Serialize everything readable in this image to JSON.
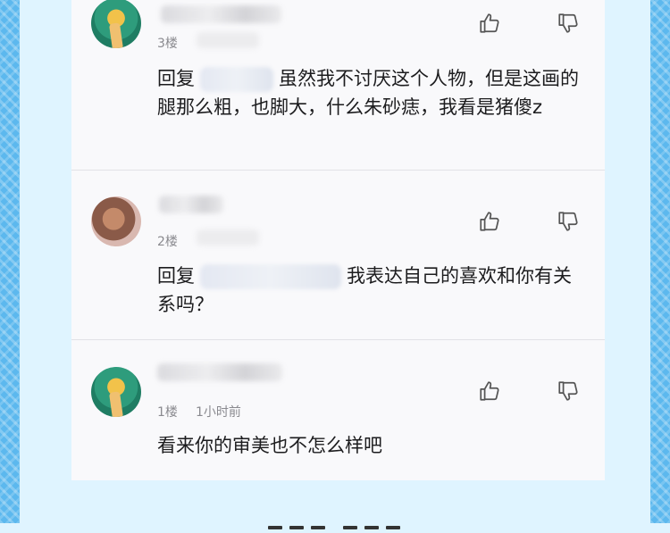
{
  "comments": [
    {
      "floor": "3楼",
      "time": "",
      "reply_prefix": "回复",
      "text_after_reply": "虽然我不讨厌这个人物，但是这画的腿那么粗，也脚大，什么朱砂痣，我看是猪傻z"
    },
    {
      "floor": "2楼",
      "time": "",
      "reply_prefix": "回复",
      "text_after_reply": "我表达自己的喜欢和你有关系吗？"
    },
    {
      "floor": "1楼",
      "time": "1小时前",
      "reply_prefix": "",
      "text_after_reply": "看来你的审美也不怎么样吧"
    }
  ],
  "icons": {
    "like": "thumbs-up-icon",
    "dislike": "thumbs-down-icon"
  },
  "colors": {
    "page_background": "#dff4ff",
    "side_border": "#5cb8ee",
    "card_background": "#f9f9fb",
    "meta_text": "#8a8a8f",
    "body_text": "#1c1c1e"
  }
}
